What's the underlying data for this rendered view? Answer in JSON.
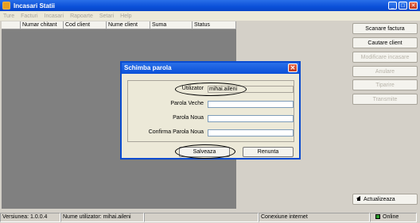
{
  "window": {
    "title": "Incasari Statii"
  },
  "menu": [
    "Ture",
    "Facturi",
    "Incasari",
    "Rapoarte",
    "Setari",
    "Help"
  ],
  "table": {
    "columns": [
      "",
      "Numar chitant",
      "Cod client",
      "Nume client",
      "Suma",
      "Status"
    ]
  },
  "side_buttons": {
    "scan": "Scanare factura",
    "search": "Cautare client",
    "modify": "Modificare incasare",
    "cancel": "Anulare",
    "print": "Tiparire",
    "send": "Transmite",
    "refresh": "Actualizeaza"
  },
  "dialog": {
    "title": "Schimba parola",
    "user_label": "Utilizator",
    "user_value": "mihai.aileni",
    "old_label": "Parola Veche",
    "new_label": "Parola Noua",
    "confirm_label": "Confirma Parola Noua",
    "save": "Salveaza",
    "cancel": "Renunta"
  },
  "status": {
    "version": "Versiunea: 1.0.0.4",
    "user": "Nume utilizator: mihai.aileni",
    "empty": "",
    "connection": "Conexiune internet",
    "online": "Online"
  }
}
